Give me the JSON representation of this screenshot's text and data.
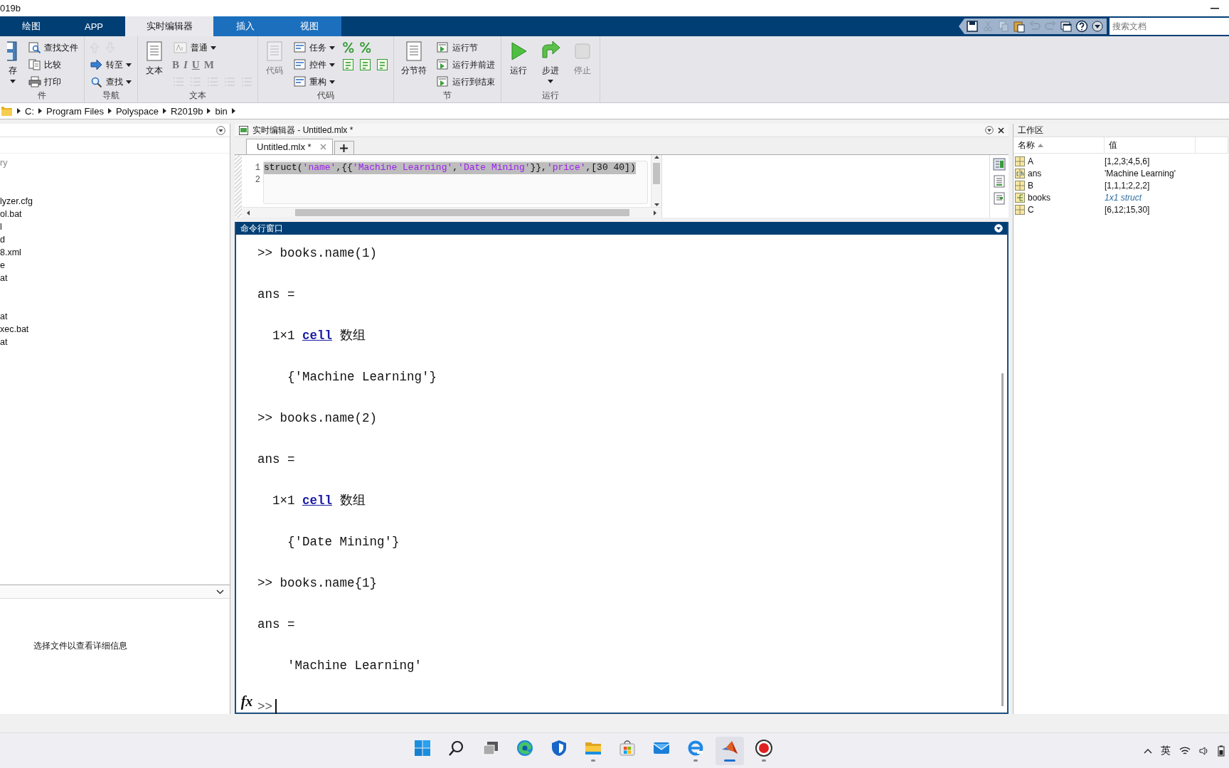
{
  "window": {
    "title": "019b"
  },
  "tabs": [
    {
      "label": "绘图",
      "selected": false,
      "contextual": false
    },
    {
      "label": "APP",
      "selected": false,
      "contextual": false
    },
    {
      "label": "实时编辑器",
      "selected": true,
      "contextual": true
    },
    {
      "label": "插入",
      "selected": false,
      "contextual": true
    },
    {
      "label": "视图",
      "selected": false,
      "contextual": true
    }
  ],
  "quick_access": [
    {
      "disabled": false
    },
    {
      "disabled": true
    },
    {
      "disabled": true
    },
    {
      "disabled": false
    },
    {
      "disabled": true
    },
    {
      "disabled": true
    },
    {
      "disabled": false
    },
    {
      "disabled": false
    },
    {
      "disabled": false
    }
  ],
  "search": {
    "placeholder": "搜索文档"
  },
  "ribbon": {
    "groups": [
      {
        "label": "件",
        "columns": [
          {
            "kind": "large",
            "label": "存",
            "dropdown": true,
            "disabled": false
          },
          {
            "kind": "stack",
            "rows": [
              {
                "kind": "small",
                "label": "查找文件",
                "dropdown": false,
                "disabled": false
              },
              {
                "kind": "small",
                "label": "比较",
                "dropdown": false,
                "disabled": false
              },
              {
                "kind": "small",
                "label": "打印",
                "dropdown": false,
                "disabled": false
              }
            ]
          }
        ]
      },
      {
        "label": "导航",
        "columns": [
          {
            "kind": "stack",
            "rows": [
              {
                "kind": "icons",
                "items": [
                  {
                    "disabled": true
                  },
                  {
                    "disabled": true
                  }
                ]
              },
              {
                "kind": "small",
                "label": "转至",
                "dropdown": true,
                "disabled": false
              },
              {
                "kind": "small",
                "label": "查找",
                "dropdown": true,
                "disabled": false
              }
            ]
          }
        ]
      },
      {
        "label": "文本",
        "columns": [
          {
            "kind": "large",
            "label": "文本",
            "dropdown": false,
            "disabled": false
          },
          {
            "kind": "stack",
            "rows": [
              {
                "kind": "small",
                "label": "普通",
                "dropdown": true,
                "disabled": false
              },
              {
                "kind": "icons",
                "items": [
                  {
                    "label": "B",
                    "disabled": true
                  },
                  {
                    "label": "I",
                    "disabled": true
                  },
                  {
                    "label": "U",
                    "disabled": true
                  },
                  {
                    "label": "M",
                    "disabled": true
                  }
                ]
              },
              {
                "kind": "icons",
                "items": [
                  {
                    "disabled": true
                  },
                  {
                    "disabled": true
                  },
                  {
                    "disabled": true
                  },
                  {
                    "disabled": true
                  },
                  {
                    "disabled": true
                  }
                ]
              }
            ]
          }
        ]
      },
      {
        "label": "代码",
        "columns": [
          {
            "kind": "large",
            "label": "代码",
            "dropdown": false,
            "disabled": true
          },
          {
            "kind": "stack",
            "rows": [
              {
                "kind": "small",
                "label": "任务",
                "dropdown": true,
                "disabled": false
              },
              {
                "kind": "small",
                "label": "控件",
                "dropdown": true,
                "disabled": false
              },
              {
                "kind": "small",
                "label": "重构",
                "dropdown": true,
                "disabled": false
              }
            ]
          },
          {
            "kind": "stack",
            "rows": [
              {
                "kind": "icons",
                "items": [
                  {
                    "disabled": false
                  },
                  {
                    "disabled": false
                  }
                ]
              },
              {
                "kind": "icons",
                "items": [
                  {
                    "disabled": false
                  },
                  {
                    "disabled": false
                  },
                  {
                    "disabled": false
                  }
                ]
              }
            ]
          }
        ]
      },
      {
        "label": "节",
        "columns": [
          {
            "kind": "large",
            "label": "分节符",
            "dropdown": false,
            "disabled": false
          },
          {
            "kind": "stack",
            "rows": [
              {
                "kind": "small",
                "label": "运行节",
                "dropdown": false,
                "disabled": false
              },
              {
                "kind": "small",
                "label": "运行并前进",
                "dropdown": false,
                "disabled": false
              },
              {
                "kind": "small",
                "label": "运行到结束",
                "dropdown": false,
                "disabled": false
              }
            ]
          }
        ]
      },
      {
        "label": "运行",
        "columns": [
          {
            "kind": "large",
            "label": "运行",
            "dropdown": false,
            "disabled": false
          },
          {
            "kind": "large",
            "label": "步进",
            "dropdown": true,
            "disabled": false
          },
          {
            "kind": "large",
            "label": "停止",
            "dropdown": false,
            "disabled": true
          }
        ]
      }
    ]
  },
  "address_bar": {
    "path": [
      "C:",
      "Program Files",
      "Polyspace",
      "R2019b",
      "bin"
    ]
  },
  "file_browser": {
    "blocks": [
      [
        {
          "name": "ry",
          "dimmed": true
        }
      ],
      [
        {
          "name": "lyzer.cfg",
          "dimmed": false
        },
        {
          "name": "ol.bat",
          "dimmed": false
        },
        {
          "name": "l",
          "dimmed": false
        },
        {
          "name": "d",
          "dimmed": false
        },
        {
          "name": "8.xml",
          "dimmed": false
        },
        {
          "name": "e",
          "dimmed": false
        },
        {
          "name": "at",
          "dimmed": false
        }
      ],
      [
        {
          "name": "at",
          "dimmed": false
        },
        {
          "name": "xec.bat",
          "dimmed": false
        },
        {
          "name": "at",
          "dimmed": false
        }
      ]
    ],
    "details": "选择文件以查看详细信息"
  },
  "live_editor": {
    "title": "实时编辑器 - Untitled.mlx *",
    "tabs": [
      {
        "label": "Untitled.mlx *",
        "selected": true
      }
    ],
    "lines": [
      {
        "number": "1",
        "selected": true,
        "segments": [
          {
            "text": "struct(",
            "kind": "plain"
          },
          {
            "text": "'name'",
            "kind": "string"
          },
          {
            "text": ",{{",
            "kind": "plain"
          },
          {
            "text": "'Machine Learning'",
            "kind": "string"
          },
          {
            "text": ",",
            "kind": "plain"
          },
          {
            "text": "'Date Mining'",
            "kind": "string"
          },
          {
            "text": "}},",
            "kind": "plain"
          },
          {
            "text": "'price'",
            "kind": "string"
          },
          {
            "text": ",[30 40])",
            "kind": "plain"
          }
        ]
      },
      {
        "number": "2",
        "selected": false
      }
    ]
  },
  "command_window": {
    "title": "命令行窗口",
    "fx": "fx",
    "prompt": ">>",
    "lines": [
      {
        "segments": [
          {
            "text": ">> books.name(1)",
            "kind": "text"
          }
        ]
      },
      {
        "segments": [
          {
            "text": "ans =",
            "kind": "text"
          }
        ]
      },
      {
        "segments": [
          {
            "text": "  1×1 ",
            "kind": "text"
          },
          {
            "text": "cell",
            "kind": "link"
          },
          {
            "text": " 数组",
            "kind": "text"
          }
        ]
      },
      {
        "segments": [
          {
            "text": "    {'Machine Learning'}",
            "kind": "text"
          }
        ]
      },
      {
        "segments": [
          {
            "text": ">> books.name(2)",
            "kind": "text"
          }
        ]
      },
      {
        "segments": [
          {
            "text": "ans =",
            "kind": "text"
          }
        ]
      },
      {
        "segments": [
          {
            "text": "  1×1 ",
            "kind": "text"
          },
          {
            "text": "cell",
            "kind": "link"
          },
          {
            "text": " 数组",
            "kind": "text"
          }
        ]
      },
      {
        "segments": [
          {
            "text": "    {'Date Mining'}",
            "kind": "text"
          }
        ]
      },
      {
        "segments": [
          {
            "text": ">> books.name{1}",
            "kind": "text"
          }
        ]
      },
      {
        "segments": [
          {
            "text": "ans =",
            "kind": "text"
          }
        ]
      },
      {
        "segments": [
          {
            "text": "    'Machine Learning'",
            "kind": "text"
          }
        ]
      }
    ]
  },
  "workspace": {
    "title": "工作区",
    "columns": [
      {
        "label": "名称",
        "sorted": true
      },
      {
        "label": "值",
        "sorted": false
      }
    ],
    "rows": [
      {
        "name": "A",
        "value": "[1,2,3;4,5,6]",
        "kind": "matrix"
      },
      {
        "name": "ans",
        "value": "'Machine Learning'",
        "kind": "char"
      },
      {
        "name": "B",
        "value": "[1,1,1;2,2,2]",
        "kind": "matrix"
      },
      {
        "name": "books",
        "value": "1x1 struct",
        "kind": "struct"
      },
      {
        "name": "C",
        "value": "[6,12;15,30]",
        "kind": "matrix"
      }
    ]
  },
  "taskbar": {
    "apps": [
      {
        "kind": "start",
        "running": false,
        "selected": false
      },
      {
        "kind": "search",
        "running": false,
        "selected": false
      },
      {
        "kind": "taskview",
        "running": false,
        "selected": false
      },
      {
        "kind": "edge",
        "running": false,
        "selected": false
      },
      {
        "kind": "shield",
        "running": false,
        "selected": false
      },
      {
        "kind": "folder",
        "running": true,
        "selected": false
      },
      {
        "kind": "store",
        "running": false,
        "selected": false
      },
      {
        "kind": "mail",
        "running": false,
        "selected": false
      },
      {
        "kind": "ie",
        "running": true,
        "selected": false
      },
      {
        "kind": "matlab",
        "running": true,
        "selected": true
      },
      {
        "kind": "record",
        "running": true,
        "selected": false
      }
    ],
    "language": "英"
  }
}
